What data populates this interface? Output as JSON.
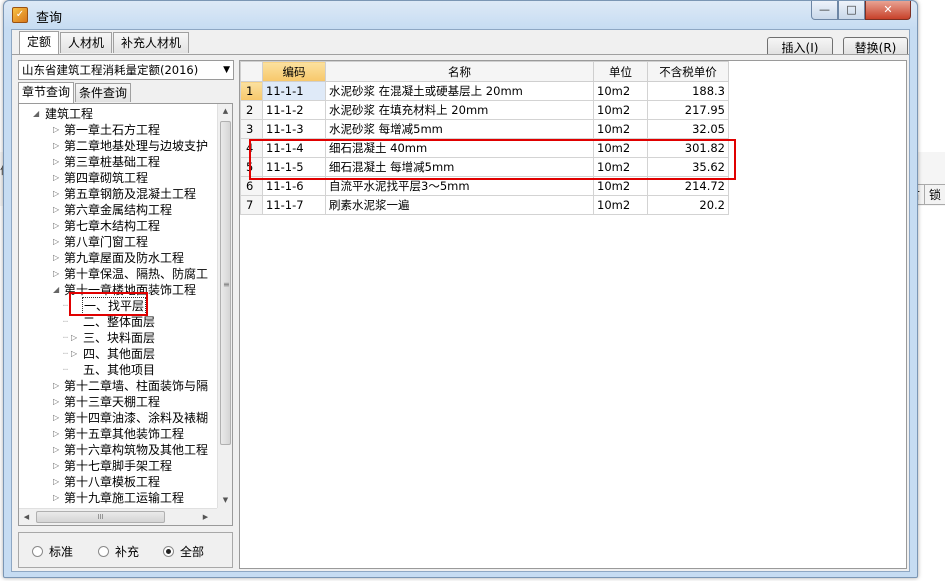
{
  "window": {
    "title": "查询",
    "app_icon": "quota-app-icon"
  },
  "title_buttons": {
    "minimize": "—",
    "maximize": "□",
    "close": "✕"
  },
  "top_tabs": [
    {
      "label": "定额"
    },
    {
      "label": "人材机"
    },
    {
      "label": "补充人材机"
    }
  ],
  "actions": {
    "insert": "插入(I)",
    "replace": "替换(R)"
  },
  "background": {
    "left_text": "价",
    "right_cells": [
      "古",
      "锁"
    ]
  },
  "quota_combo": {
    "value": "山东省建筑工程消耗量定额(2016)"
  },
  "search_tabs": [
    {
      "label": "章节查询"
    },
    {
      "label": "条件查询"
    }
  ],
  "tree": [
    {
      "label": "建筑工程",
      "level": 0,
      "expander": "◢"
    },
    {
      "label": "第一章土石方工程",
      "level": 1,
      "expander": "▷"
    },
    {
      "label": "第二章地基处理与边坡支护",
      "level": 1,
      "expander": "▷"
    },
    {
      "label": "第三章桩基础工程",
      "level": 1,
      "expander": "▷"
    },
    {
      "label": "第四章砌筑工程",
      "level": 1,
      "expander": "▷"
    },
    {
      "label": "第五章钢筋及混凝土工程",
      "level": 1,
      "expander": "▷"
    },
    {
      "label": "第六章金属结构工程",
      "level": 1,
      "expander": "▷"
    },
    {
      "label": "第七章木结构工程",
      "level": 1,
      "expander": "▷"
    },
    {
      "label": "第八章门窗工程",
      "level": 1,
      "expander": "▷"
    },
    {
      "label": "第九章屋面及防水工程",
      "level": 1,
      "expander": "▷"
    },
    {
      "label": "第十章保温、隔热、防腐工",
      "level": 1,
      "expander": "▷"
    },
    {
      "label": "第十一章楼地面装饰工程",
      "level": 1,
      "expander": "◢"
    },
    {
      "label": "一、找平层",
      "level": 2,
      "expander": "",
      "selected": true
    },
    {
      "label": "二、整体面层",
      "level": 2,
      "expander": ""
    },
    {
      "label": "三、块料面层",
      "level": 2,
      "expander": "▷"
    },
    {
      "label": "四、其他面层",
      "level": 2,
      "expander": "▷"
    },
    {
      "label": "五、其他项目",
      "level": 2,
      "expander": ""
    },
    {
      "label": "第十二章墙、柱面装饰与隔",
      "level": 1,
      "expander": "▷"
    },
    {
      "label": "第十三章天棚工程",
      "level": 1,
      "expander": "▷"
    },
    {
      "label": "第十四章油漆、涂料及裱糊",
      "level": 1,
      "expander": "▷"
    },
    {
      "label": "第十五章其他装饰工程",
      "level": 1,
      "expander": "▷"
    },
    {
      "label": "第十六章构筑物及其他工程",
      "level": 1,
      "expander": "▷"
    },
    {
      "label": "第十七章脚手架工程",
      "level": 1,
      "expander": "▷"
    },
    {
      "label": "第十八章模板工程",
      "level": 1,
      "expander": "▷"
    },
    {
      "label": "第十九章施工运输工程",
      "level": 1,
      "expander": "▷"
    }
  ],
  "scroll": {
    "up": "▲",
    "down": "▼",
    "left": "◀",
    "right": "▶",
    "grip_v": "≡",
    "grip_h": "III"
  },
  "filters": [
    {
      "label": "标准",
      "checked": false
    },
    {
      "label": "补充",
      "checked": false
    },
    {
      "label": "全部",
      "checked": true
    }
  ],
  "grid": {
    "columns": [
      "",
      "编码",
      "名称",
      "单位",
      "不含税单价"
    ],
    "rows": [
      {
        "no": "1",
        "code": "11-1-1",
        "name": "水泥砂浆 在混凝土或硬基层上 20mm",
        "unit": "10m2",
        "price": "188.3"
      },
      {
        "no": "2",
        "code": "11-1-2",
        "name": "水泥砂浆 在填充材料上 20mm",
        "unit": "10m2",
        "price": "217.95"
      },
      {
        "no": "3",
        "code": "11-1-3",
        "name": "水泥砂浆 每增减5mm",
        "unit": "10m2",
        "price": "32.05"
      },
      {
        "no": "4",
        "code": "11-1-4",
        "name": "细石混凝土 40mm",
        "unit": "10m2",
        "price": "301.82"
      },
      {
        "no": "5",
        "code": "11-1-5",
        "name": "细石混凝土 每增减5mm",
        "unit": "10m2",
        "price": "35.62"
      },
      {
        "no": "6",
        "code": "11-1-6",
        "name": "自流平水泥找平层3～5mm",
        "unit": "10m2",
        "price": "214.72"
      },
      {
        "no": "7",
        "code": "11-1-7",
        "name": "刷素水泥浆一遍",
        "unit": "10m2",
        "price": "20.2"
      }
    ]
  },
  "colors": {
    "highlight_red": "#e00000",
    "sorted_header": "#f7c76a",
    "window_frame": "#c6dcf2"
  }
}
